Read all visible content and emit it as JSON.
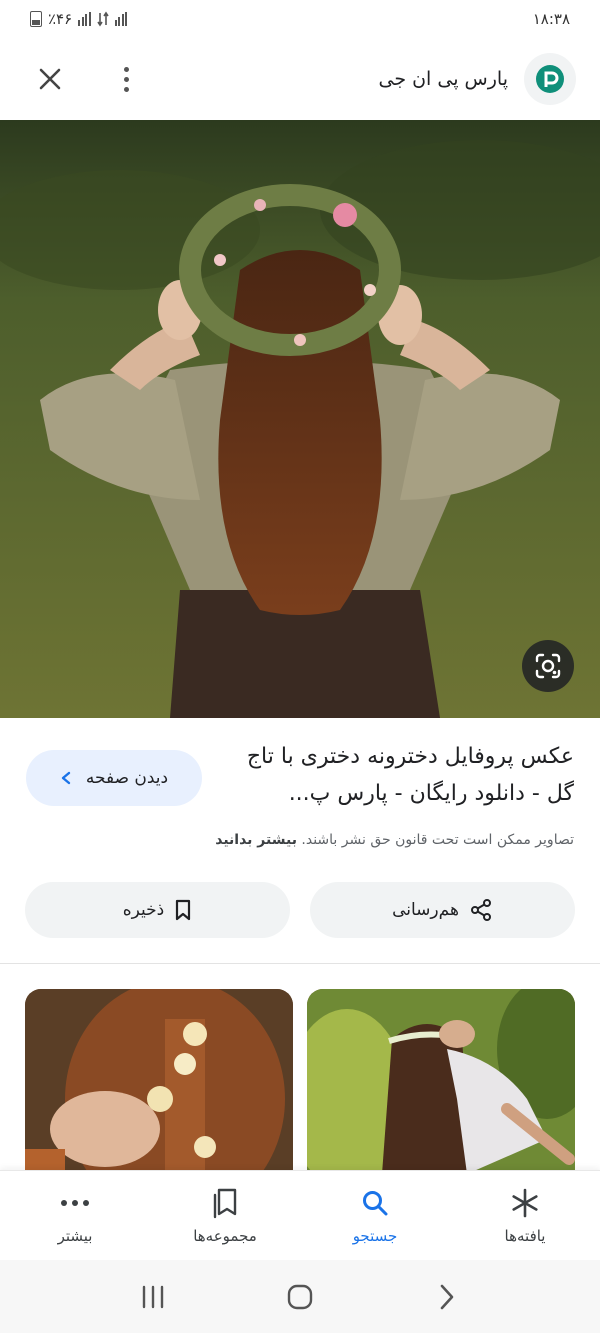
{
  "status_bar": {
    "time": "۱۸:۳۸",
    "battery_percent": "٪۴۶",
    "signal_labels": [
      "ıl.",
      "ıl."
    ]
  },
  "header": {
    "site_name": "پارس پی ان جی",
    "logo_letter": "p"
  },
  "result": {
    "title": "عکس پروفایل دخترونه دختری با تاج گل - دانلود رایگان - پارس پ...",
    "visit_label": "دیدن صفحه",
    "copyright_text": "تصاویر ممکن است تحت قانون حق نشر باشند. ",
    "learn_more": "بیشتر بدانید",
    "share_label": "هم‌رسانی",
    "save_label": "ذخیره"
  },
  "bottom_nav": {
    "items": [
      {
        "label": "یافته‌ها",
        "icon": "asterisk-icon"
      },
      {
        "label": "جستجو",
        "icon": "search-icon"
      },
      {
        "label": "مجموعه‌ها",
        "icon": "collections-icon"
      },
      {
        "label": "بیشتر",
        "icon": "more-dots-icon"
      }
    ],
    "active_index": 1
  },
  "colors": {
    "accent": "#1a73e8",
    "visit_button_bg": "#e8f0fe",
    "chip_bg": "#f1f3f4"
  }
}
